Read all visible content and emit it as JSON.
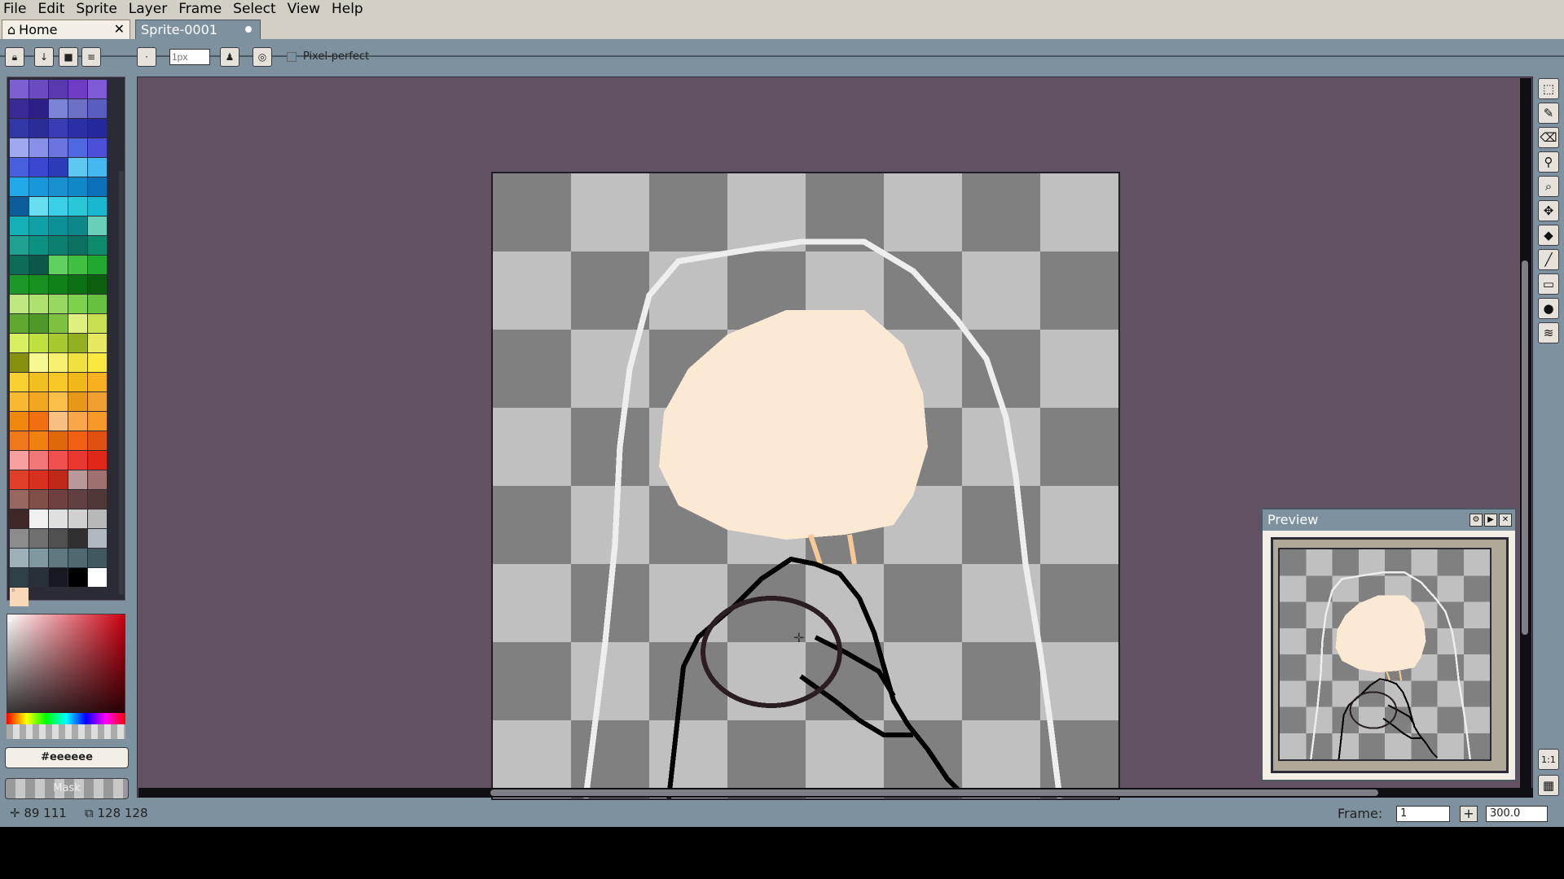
{
  "menu": [
    "File",
    "Edit",
    "Sprite",
    "Layer",
    "Frame",
    "Select",
    "View",
    "Help"
  ],
  "tabs": {
    "home": "Home",
    "sprite": "Sprite-0001",
    "close_glyph": "✕"
  },
  "context": {
    "brush_size_placeholder": "1px",
    "pixel_perfect_label": "Pixel-perfect",
    "pixel_perfect_checked": false
  },
  "palette": {
    "colors": [
      "#7a60d0",
      "#6a4cc0",
      "#5a38b0",
      "#6e3cc4",
      "#7e5ad6",
      "#3a2a98",
      "#2c2088",
      "#7c84d8",
      "#6e70c8",
      "#5a5cc0",
      "#3238a8",
      "#2a2c98",
      "#3a3cb4",
      "#2a30a4",
      "#24289a",
      "#a0a8f0",
      "#8890e8",
      "#6c74e0",
      "#4e68e0",
      "#4a50d8",
      "#4860e0",
      "#3a48d0",
      "#2c3cb8",
      "#5ec8f0",
      "#46b8f0",
      "#20a8e8",
      "#1898d8",
      "#1890d0",
      "#1088c8",
      "#0c70b8",
      "#0c5c9c",
      "#66e0f0",
      "#3ad0e8",
      "#28c8d8",
      "#1ab8d0",
      "#14b0b8",
      "#10a0a8",
      "#0c9098",
      "#0c8888",
      "#68d0b8",
      "#20a090",
      "#0c9080",
      "#0c8070",
      "#0c7060",
      "#0c8c68",
      "#0c6c58",
      "#0c5848",
      "#60d060",
      "#40c040",
      "#20a830",
      "#1c9828",
      "#189020",
      "#108018",
      "#0c7014",
      "#0c6010",
      "#c0e880",
      "#b0e070",
      "#98d860",
      "#80d050",
      "#68c040",
      "#60a830",
      "#509828",
      "#80c040",
      "#e0f080",
      "#c8e050",
      "#d8f060",
      "#c0e040",
      "#a8c830",
      "#90b020",
      "#e8e860",
      "#889010",
      "#f8f890",
      "#f8f070",
      "#f0e040",
      "#f8e840",
      "#f8d030",
      "#f0c020",
      "#f8c828",
      "#f0b818",
      "#f8b020",
      "#f8b830",
      "#f0a820",
      "#f8c048",
      "#e89818",
      "#f0a030",
      "#f08810",
      "#f07010",
      "#f8c080",
      "#f8a848",
      "#f89828",
      "#f07818",
      "#f08010",
      "#e06808",
      "#f06010",
      "#e05010",
      "#f8a0a0",
      "#f07878",
      "#f05050",
      "#e83830",
      "#e02818",
      "#e04028",
      "#d83020",
      "#c02818",
      "#b89898",
      "#a07070",
      "#986860",
      "#805048",
      "#704040",
      "#604040",
      "#503838",
      "#402828",
      "#f0f0f0",
      "#e0e0e0",
      "#d0d0d0",
      "#b8b8b8",
      "#8c8c8c",
      "#707070",
      "#505050",
      "#303030",
      "#b0b8c0",
      "#a0b0b8",
      "#8098a0",
      "#607880",
      "#506870",
      "#405860",
      "#304048",
      "#283038",
      "#181820",
      "#000000",
      "#ffffff",
      "#f8d8b8"
    ]
  },
  "color": {
    "hex_label": "#eeeeee",
    "mask_label": "Mask",
    "picker_hue": "#cc0011"
  },
  "sprite": {
    "fill_color": "#fbe9d3",
    "outline_color": "#eeeeee",
    "ink_color": "#000000",
    "ring_color": "#2a1e22",
    "neck_color": "#f8c896",
    "checker_light": "#c0c0c0",
    "checker_dark": "#808080",
    "background": "#625264"
  },
  "preview": {
    "title": "Preview",
    "btn_settings": "⚙",
    "btn_play": "▶",
    "btn_close": "✕"
  },
  "tools": [
    "rectangular-marquee-icon",
    "pencil-icon",
    "eraser-icon",
    "eyedropper-icon",
    "zoom-icon",
    "move-icon",
    "paint-bucket-icon",
    "line-icon",
    "rectangle-icon",
    "contour-icon",
    "blur-icon"
  ],
  "toolbar2": {
    "ratio_label": "1:1",
    "grid_label": "▦"
  },
  "status": {
    "cursor_pos": "89  111",
    "sprite_size": "128  128",
    "frame_label": "Frame:",
    "frame_value": "1",
    "add_frame": "+",
    "zoom": "300.0"
  }
}
